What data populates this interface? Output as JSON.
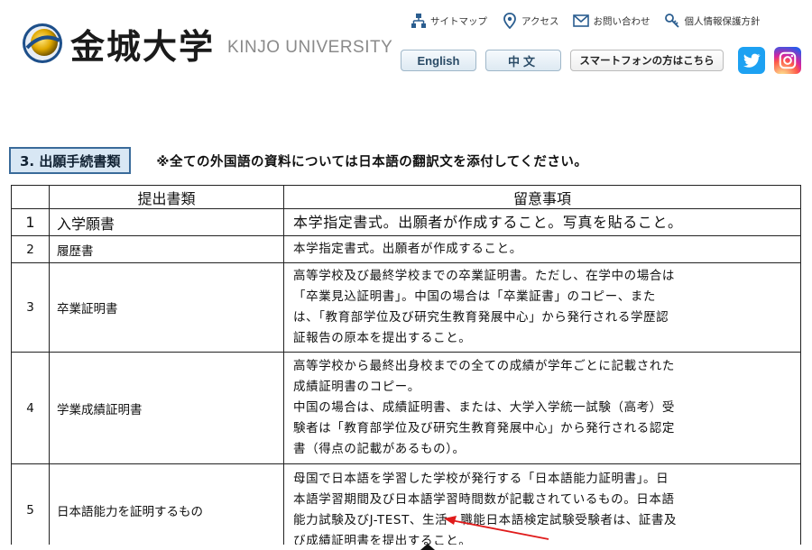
{
  "header": {
    "logo_jp": "金城大学",
    "logo_en": "KINJO UNIVERSITY",
    "util_links": [
      {
        "label": "サイトマップ",
        "icon": "sitemap-icon"
      },
      {
        "label": "アクセス",
        "icon": "location-pin-icon"
      },
      {
        "label": "お問い合わせ",
        "icon": "mail-icon"
      },
      {
        "label": "個人情報保護方針",
        "icon": "key-icon"
      }
    ],
    "btn_english": "English",
    "btn_chinese": "中文",
    "btn_smartphone": "スマートフォンの方はこちら",
    "sns": [
      "twitter-icon",
      "instagram-icon"
    ],
    "colors": {
      "twitter": "#1da1f2",
      "button_text": "#2a4b66",
      "section_border": "#3a6b9a"
    }
  },
  "section": {
    "title": "3. 出願手続書類",
    "note": "※全ての外国語の資料については日本語の翻訳文を添付してください。"
  },
  "table": {
    "headers": [
      "",
      "提出書類",
      "留意事項"
    ],
    "rows": [
      {
        "no": "1",
        "doc": "入学願書",
        "note": [
          "本学指定書式。出願者が作成すること。写真を貼ること。"
        ]
      },
      {
        "no": "2",
        "doc": "履歴書",
        "note": [
          "本学指定書式。出願者が作成すること。"
        ]
      },
      {
        "no": "3",
        "doc": "卒業証明書",
        "note": [
          "高等学校及び最終学校までの卒業証明書。ただし、在学中の場合は",
          "「卒業見込証明書」。中国の場合は「卒業証書」のコピー、また",
          "は、「教育部学位及び研究生教育発展中心」から発行される学歴認",
          "証報告の原本を提出すること。"
        ]
      },
      {
        "no": "4",
        "doc": "学業成績証明書",
        "note": [
          "高等学校から最終出身校までの全ての成績が学年ごとに記載された",
          "成績証明書のコピー。",
          "中国の場合は、成績証明書、または、大学入学統一試験（高考）受",
          "験者は「教育部学位及び研究生教育発展中心」から発行される認定",
          "書（得点の記載があるもの）。"
        ]
      },
      {
        "no": "5",
        "doc": "日本語能力を証明するもの",
        "note": [
          "母国で日本語を学習した学校が発行する「日本語能力証明書」。日",
          "本語学習期間及び日本語学習時間数が記載されているもの。日本語",
          "能力試験及びJ-TEST、生活・職能日本語検定試験受験者は、証書及",
          "び成績証明書を提出すること。"
        ]
      }
    ]
  }
}
